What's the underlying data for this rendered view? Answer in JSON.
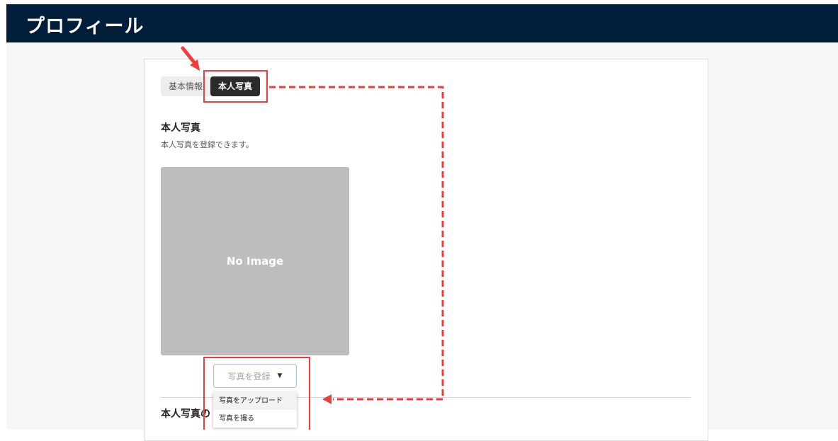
{
  "header": {
    "title": "プロフィール"
  },
  "tabs": [
    {
      "label": "基本情報",
      "active": false
    },
    {
      "label": "本人写真",
      "active": true
    }
  ],
  "section": {
    "title": "本人写真",
    "description": "本人写真を登録できます。",
    "placeholder_text": "No Image"
  },
  "upload_button": {
    "label": "写真を登録"
  },
  "dropdown": {
    "items": [
      {
        "label": "写真をアップロード"
      },
      {
        "label": "写真を撮る"
      }
    ]
  },
  "section2": {
    "title_partial": "本人写真の"
  },
  "colors": {
    "header_bg": "#001d3a",
    "active_tab_bg": "#2a2a2a",
    "annotation_red": "#ee3b3b",
    "placeholder_bg": "#bdbdbf"
  }
}
